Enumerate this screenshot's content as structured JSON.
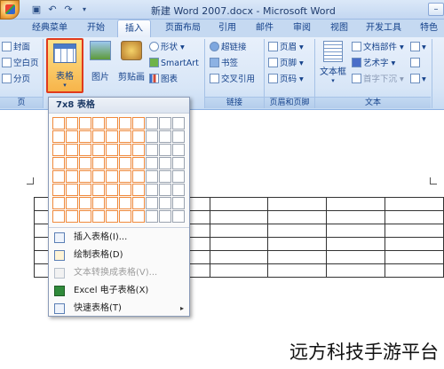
{
  "window": {
    "title": "新建 Word 2007.docx - Microsoft Word",
    "controls": [
      "–",
      "□",
      "×"
    ]
  },
  "tabs": [
    {
      "label": "经典菜单",
      "active": false
    },
    {
      "label": "开始",
      "active": false
    },
    {
      "label": "插入",
      "active": true
    },
    {
      "label": "页面布局",
      "active": false
    },
    {
      "label": "引用",
      "active": false
    },
    {
      "label": "邮件",
      "active": false
    },
    {
      "label": "审阅",
      "active": false
    },
    {
      "label": "视图",
      "active": false
    },
    {
      "label": "开发工具",
      "active": false
    },
    {
      "label": "特色",
      "active": false
    }
  ],
  "ribbon": {
    "pages_group": {
      "items": [
        "封面",
        "空白页",
        "分页"
      ],
      "label": "页"
    },
    "table_button": {
      "label": "表格"
    },
    "illustrations": {
      "picture": "图片",
      "clipart": "剪贴画",
      "shapes": "形状",
      "smartart": "SmartArt",
      "chart": "图表"
    },
    "links_group": {
      "items": [
        "超链接",
        "书签",
        "交叉引用"
      ],
      "label": "链接"
    },
    "header_footer_group": {
      "items": [
        "页眉",
        "页脚",
        "页码"
      ],
      "label": "页眉和页脚"
    },
    "text_group": {
      "textbox": "文本框",
      "quickparts": "文档部件",
      "wordart": "艺术字",
      "dropcap": "首字下沉",
      "label": "文本"
    }
  },
  "dropdown": {
    "header": "7x8 表格",
    "grid": {
      "cols": 10,
      "rows": 8,
      "selected_cols": 7,
      "selected_rows": 8
    },
    "menu": [
      {
        "label": "插入表格(I)...",
        "enabled": true
      },
      {
        "label": "绘制表格(D)",
        "enabled": true
      },
      {
        "label": "文本转换成表格(V)...",
        "enabled": false
      },
      {
        "label": "Excel 电子表格(X)",
        "enabled": true
      },
      {
        "label": "快速表格(T)",
        "enabled": true,
        "submenu": true
      }
    ]
  },
  "watermark": "远方科技手游平台"
}
